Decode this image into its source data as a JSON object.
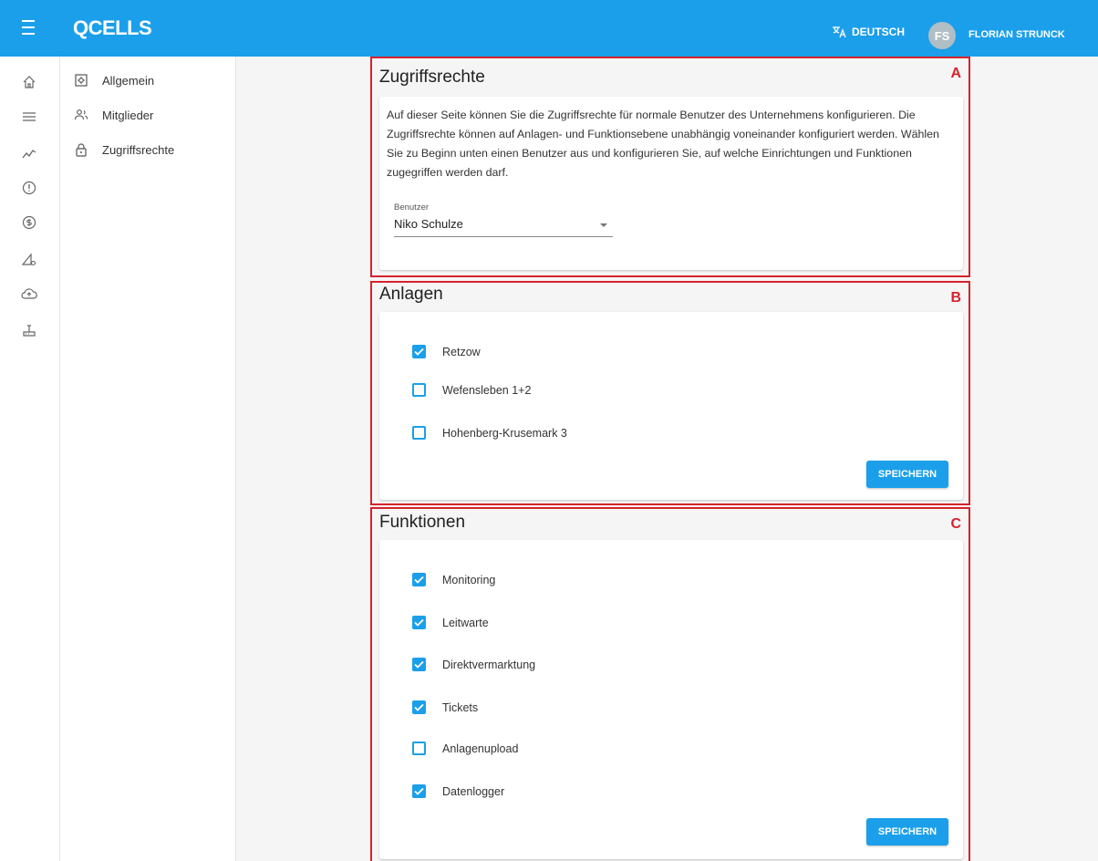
{
  "header": {
    "logo": "QCELLS",
    "language": "DEUTSCH",
    "avatar_initials": "FS",
    "user_name": "FLORIAN STRUNCK",
    "bar_color": "#1b9fea"
  },
  "rail": {
    "icons": [
      "home-icon",
      "list-icon",
      "trend-chart-icon",
      "alert-circle-icon",
      "dollar-circle-icon",
      "ruler-gear-icon",
      "cloud-upload-icon",
      "datalogger-icon"
    ]
  },
  "subnav": {
    "items": [
      {
        "label": "Allgemein",
        "icon": "settings-box-icon"
      },
      {
        "label": "Mitglieder",
        "icon": "people-icon"
      },
      {
        "label": "Zugriffsrechte",
        "icon": "lock-icon"
      }
    ]
  },
  "section_a": {
    "title": "Zugriffsrechte",
    "letter": "A",
    "description": "Auf dieser Seite können Sie die Zugriffsrechte für normale Benutzer des Unternehmens konfigurieren. Die Zugriffsrechte können auf Anlagen- und Funktionsebene unabhängig voneinander konfiguriert werden. Wählen Sie zu Beginn unten einen Benutzer aus und konfigurieren Sie, auf welche Einrichtungen und Funktionen zugegriffen werden darf.",
    "select_label": "Benutzer",
    "select_value": "Niko Schulze"
  },
  "section_b": {
    "title": "Anlagen",
    "letter": "B",
    "items": [
      {
        "label": "Retzow",
        "checked": true
      },
      {
        "label": "Wefensleben 1+2",
        "checked": false
      },
      {
        "label": "Hohenberg-Krusemark 3",
        "checked": false
      }
    ],
    "save_label": "SPEICHERN"
  },
  "section_c": {
    "title": "Funktionen",
    "letter": "C",
    "items": [
      {
        "label": "Monitoring",
        "checked": true
      },
      {
        "label": "Leitwarte",
        "checked": true
      },
      {
        "label": "Direktvermarktung",
        "checked": true
      },
      {
        "label": "Tickets",
        "checked": true
      },
      {
        "label": "Anlagenupload",
        "checked": false
      },
      {
        "label": "Datenlogger",
        "checked": true
      }
    ],
    "save_label": "SPEICHERN"
  },
  "colors": {
    "accent": "#1b9fea",
    "highlight_border": "#d6232b"
  }
}
